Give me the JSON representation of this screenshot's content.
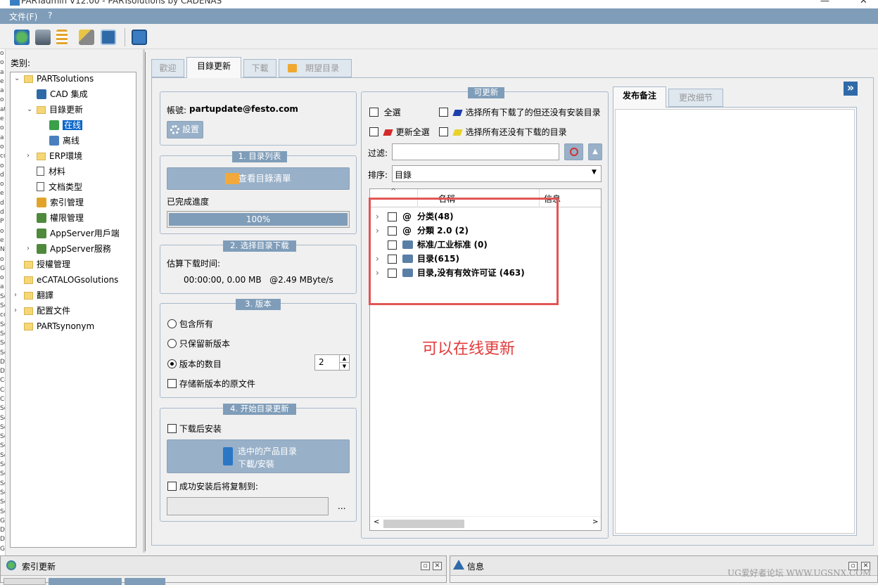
{
  "window": {
    "title": "PARTadmin V12.00 - PARTsolutions by CADENAS",
    "close_symbol": "✕"
  },
  "menu": {
    "file": "文件(F)",
    "help": "?"
  },
  "left_strip_chars": [
    "o",
    "o",
    "a",
    "e",
    "a",
    "o",
    "at",
    "e",
    "o",
    "a",
    "o",
    "co",
    "o",
    "d",
    "o",
    "e",
    "d",
    "d",
    "P",
    "o",
    "e",
    "N",
    "o",
    "G",
    "o",
    "a",
    "So",
    "So",
    "co",
    "So",
    "So",
    "So",
    "So",
    "Do",
    "Do",
    "Co",
    "Co",
    "Co",
    "So",
    "So",
    "So",
    "So",
    "So",
    "So",
    "So",
    "So",
    "So",
    "So",
    "So",
    "So",
    "Ga",
    "Do",
    "Do",
    "Ga"
  ],
  "category_panel": {
    "title": "类别:",
    "tree": [
      {
        "label": "PARTsolutions",
        "icon": "folder-icon",
        "level": 0,
        "expand": "expanded"
      },
      {
        "label": "CAD 集成",
        "icon": "cad-integration-icon",
        "level": 1,
        "expand": ""
      },
      {
        "label": "目錄更新",
        "icon": "folder-icon",
        "level": 1,
        "expand": "expanded"
      },
      {
        "label": "在线",
        "icon": "online-globe-icon",
        "level": 2,
        "expand": "",
        "selected": true
      },
      {
        "label": "离线",
        "icon": "offline-icon",
        "level": 2,
        "expand": ""
      },
      {
        "label": "ERP環境",
        "icon": "folder-icon",
        "level": 1,
        "expand": "collapsed"
      },
      {
        "label": "材料",
        "icon": "document-icon",
        "level": 1,
        "expand": ""
      },
      {
        "label": "文档类型",
        "icon": "document-icon",
        "level": 1,
        "expand": ""
      },
      {
        "label": "索引管理",
        "icon": "index-tree-icon",
        "level": 1,
        "expand": ""
      },
      {
        "label": "權限管理",
        "icon": "permissions-icon",
        "level": 1,
        "expand": ""
      },
      {
        "label": "AppServer用戶端",
        "icon": "appserver-client-icon",
        "level": 1,
        "expand": ""
      },
      {
        "label": "AppServer服務",
        "icon": "appserver-service-icon",
        "level": 1,
        "expand": "collapsed"
      },
      {
        "label": "授權管理",
        "icon": "folder-icon",
        "level": 0,
        "expand": ""
      },
      {
        "label": "eCATALOGsolutions",
        "icon": "folder-icon",
        "level": 0,
        "expand": ""
      },
      {
        "label": "翻譯",
        "icon": "folder-icon",
        "level": 0,
        "expand": "collapsed"
      },
      {
        "label": "配置文件",
        "icon": "folder-icon",
        "level": 0,
        "expand": "collapsed"
      },
      {
        "label": "PARTsynonym",
        "icon": "folder-icon",
        "level": 0,
        "expand": ""
      }
    ]
  },
  "tabs": [
    {
      "label": "歡迎",
      "active": false
    },
    {
      "label": "目錄更新",
      "active": true
    },
    {
      "label": "下載",
      "active": false
    },
    {
      "label": "期望目录",
      "active": false
    }
  ],
  "account": {
    "label": "帳號:",
    "value": "partupdate@festo.com",
    "settings_button": "設置"
  },
  "group1": {
    "legend": "1. 目录列表",
    "view_button": "查看目錄清單",
    "progress_label": "已完成進度",
    "progress_text": "100%",
    "progress_value": 1.0
  },
  "group2": {
    "legend": "2. 选择目录下载",
    "estimate_label": "估算下载时间:",
    "estimate_value": "00:00:00, 0.00 MB   @2.49 MByte/s"
  },
  "group3": {
    "legend": "3. 版本",
    "options": [
      {
        "label": "包含所有",
        "checked": false
      },
      {
        "label": "只保留新版本",
        "checked": false
      },
      {
        "label": "版本的数目",
        "checked": true
      }
    ],
    "version_count": "2",
    "store_original": "存储新版本的原文件"
  },
  "group4": {
    "legend": "4. 开始目录更新",
    "install_after": "下载后安装",
    "download_button_line1": "选中的产品目录",
    "download_button_line2": "下載/安裝",
    "copy_after": "成功安装后将复制到:",
    "copy_path": "",
    "browse": "..."
  },
  "available": {
    "legend": "可更新",
    "select_all": "全選",
    "select_downloaded_not_installed": "选择所有下载了的但还没有安装目录",
    "update_all": "更新全選",
    "select_not_downloaded": "选择所有还没有下载的目录",
    "filter_label": "过滤:",
    "filter_value": "",
    "sort_label": "排序:",
    "sort_value": "目錄",
    "columns": [
      "名稱",
      "信息"
    ],
    "items": [
      {
        "label": "分类(48)",
        "icon": "at-icon",
        "expandable": true
      },
      {
        "label": "分類 2.0 (2)",
        "icon": "at-icon",
        "expandable": true
      },
      {
        "label": "标准/工业标准 (0)",
        "icon": "database-icon",
        "expandable": false
      },
      {
        "label": "目录(615)",
        "icon": "database-icon",
        "expandable": true
      },
      {
        "label": "目录,没有有效许可证 (463)",
        "icon": "database-icon",
        "expandable": true
      }
    ],
    "annotation": "可以在线更新",
    "annotation_color": "#e23b3b"
  },
  "notes": {
    "tab_release_notes": "发布备注",
    "tab_change_details": "更改细节",
    "collapse_symbol": "»"
  },
  "bottom": {
    "index_update_title": "索引更新",
    "info_title": "信息",
    "watermark": "UG爱好者论坛 WWW.UGSNX.COM"
  },
  "colors": {
    "accent_blue": "#7f9db9",
    "button_blue": "#98b0c8",
    "progress_fill": "#7f9db9",
    "annotation_red": "#e23b3b"
  }
}
